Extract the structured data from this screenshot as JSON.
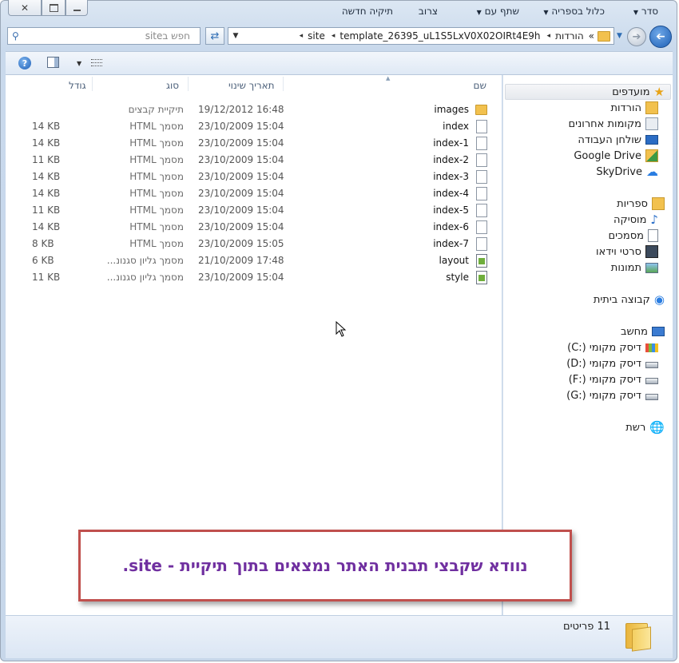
{
  "window": {
    "caption_buttons": [
      "close-icon",
      "restore-icon",
      "minimize-icon"
    ]
  },
  "address_bar": {
    "overflow": "«",
    "segments": [
      "הורדות",
      "template_26395_uL1S5LxV0X02OIRt4E9h",
      "site"
    ],
    "separator": "◂"
  },
  "search": {
    "placeholder": "חפש בsite"
  },
  "toolbar": {
    "organize": "סדר",
    "include_in_library": "כלול בספריה",
    "share_with": "שתף עם",
    "burn": "צרוב",
    "new_folder": "תיקיה חדשה"
  },
  "columns": {
    "name": "שם",
    "date": "תאריך שינוי",
    "type": "סוג",
    "size": "גודל"
  },
  "files": [
    {
      "name": "images",
      "date": "19/12/2012 16:48",
      "type": "תיקיית קבצים",
      "size": "",
      "icon": "folder-icon"
    },
    {
      "name": "index",
      "date": "23/10/2009 15:04",
      "type": "מסמך HTML",
      "size": "14 KB",
      "icon": "document-icon"
    },
    {
      "name": "index-1",
      "date": "23/10/2009 15:04",
      "type": "מסמך HTML",
      "size": "14 KB",
      "icon": "document-icon"
    },
    {
      "name": "index-2",
      "date": "23/10/2009 15:04",
      "type": "מסמך HTML",
      "size": "11 KB",
      "icon": "document-icon"
    },
    {
      "name": "index-3",
      "date": "23/10/2009 15:04",
      "type": "מסמך HTML",
      "size": "14 KB",
      "icon": "document-icon"
    },
    {
      "name": "index-4",
      "date": "23/10/2009 15:04",
      "type": "מסמך HTML",
      "size": "14 KB",
      "icon": "document-icon"
    },
    {
      "name": "index-5",
      "date": "23/10/2009 15:04",
      "type": "מסמך HTML",
      "size": "11 KB",
      "icon": "document-icon"
    },
    {
      "name": "index-6",
      "date": "23/10/2009 15:04",
      "type": "מסמך HTML",
      "size": "14 KB",
      "icon": "document-icon"
    },
    {
      "name": "index-7",
      "date": "23/10/2009 15:05",
      "type": "מסמך HTML",
      "size": "8 KB",
      "icon": "document-icon"
    },
    {
      "name": "layout",
      "date": "21/10/2009 17:48",
      "type": "מסמך גליון סגנונ...",
      "size": "6 KB",
      "icon": "stylesheet-icon"
    },
    {
      "name": "style",
      "date": "23/10/2009 15:04",
      "type": "מסמך גליון סגנונ...",
      "size": "11 KB",
      "icon": "stylesheet-icon"
    }
  ],
  "nav": {
    "favorites": {
      "label": "מועדפים",
      "items": [
        "הורדות",
        "מקומות אחרונים",
        "שולחן העבודה",
        "Google Drive",
        "SkyDrive"
      ]
    },
    "libraries": {
      "label": "ספריות",
      "items": [
        "מוסיקה",
        "מסמכים",
        "סרטי וידאו",
        "תמונות"
      ]
    },
    "homegroup": {
      "label": "קבוצה ביתית"
    },
    "computer": {
      "label": "מחשב",
      "items": [
        "דיסק מקומי (:C)",
        "דיסק מקומי (:D)",
        "דיסק מקומי (:F)",
        "דיסק מקומי (:G)"
      ]
    },
    "network": {
      "label": "רשת"
    }
  },
  "status": {
    "count": "11 פריטים"
  },
  "callout": {
    "text": "נוודא שקבצי תבנית האתר נמצאים בתוך תיקיית - site."
  },
  "colors": {
    "callout_border": "#c0504d",
    "callout_text": "#7030a0",
    "folder": "#f2c14e"
  }
}
